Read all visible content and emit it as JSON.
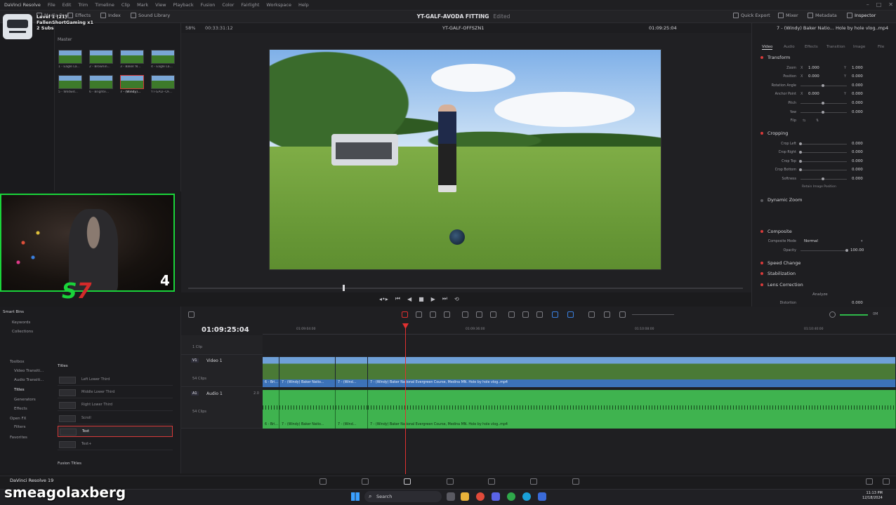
{
  "menubar": {
    "app_title": "DaVinci Resolve",
    "items": [
      "File",
      "Edit",
      "Trim",
      "Timeline",
      "Clip",
      "Mark",
      "View",
      "Playback",
      "Fusion",
      "Color",
      "Fairlight",
      "Workspace",
      "Help"
    ]
  },
  "toolbar": {
    "media_pool": "Media Pool",
    "effects": "Effects",
    "index": "Index",
    "sound_library": "Sound Library",
    "project_title": "YT-GALF-AVODA FITTING",
    "edited": "Edited",
    "quick_export": "Quick Export",
    "mixer": "Mixer",
    "metadata": "Metadata",
    "inspector": "Inspector"
  },
  "viewer": {
    "zoom": "58%",
    "source_timecode": "00:33:31:12",
    "timeline_name": "YT-GALF-OFFSZN1",
    "record_timecode": "01:09:25:04"
  },
  "overlay": {
    "line1": "Level 1 (21)",
    "line2": "FallenShortGaming x1",
    "line3": "2 Subs",
    "webcam_number": "4"
  },
  "media_pool": {
    "bin": "Master",
    "clips": [
      "1 - Eagle La...",
      "2 - Brownin...",
      "3 - Baker N...",
      "4 - Eagle La...",
      "5 - Wildwd...",
      "6 - Brighte...",
      "7 - (Windy)...",
      "YT-GALF-OF..."
    ]
  },
  "inspector": {
    "clip_title": "7 - (Windy) Baker Natio... Hole by hole vlog..mp4",
    "tabs": [
      "Video",
      "Audio",
      "Effects",
      "Transition",
      "Image",
      "File"
    ],
    "transform": {
      "title": "Transform",
      "zoom_label": "Zoom",
      "zoom_x": "1.000",
      "zoom_y": "1.000",
      "position_label": "Position",
      "position_x": "0.000",
      "position_y": "0.000",
      "rotation_label": "Rotation Angle",
      "rotation": "0.000",
      "anchor_label": "Anchor Point",
      "anchor_x": "0.000",
      "anchor_y": "0.000",
      "pitch_label": "Pitch",
      "pitch": "0.000",
      "yaw_label": "Yaw",
      "yaw": "0.000",
      "flip_label": "Flip"
    },
    "cropping": {
      "title": "Cropping",
      "left_label": "Crop Left",
      "left": "0.000",
      "right_label": "Crop Right",
      "right": "0.000",
      "top_label": "Crop Top",
      "top": "0.000",
      "bottom_label": "Crop Bottom",
      "bottom": "0.000",
      "softness_label": "Softness",
      "softness": "0.000",
      "retain_label": "Retain Image Position"
    },
    "dynamic_zoom": "Dynamic Zoom",
    "composite": {
      "title": "Composite",
      "mode_label": "Composite Mode",
      "mode": "Normal",
      "opacity_label": "Opacity",
      "opacity": "100.00"
    },
    "speed_change": "Speed Change",
    "stabilization": "Stabilization",
    "lens_correction": "Lens Correction",
    "analyze": "Analyze",
    "distortion_label": "Distortion",
    "distortion": "0.000"
  },
  "bins": {
    "smart_bins": "Smart Bins",
    "keywords": "Keywords",
    "collections": "Collections",
    "fx_tree": [
      "Toolbox",
      "Video Transiti...",
      "Audio Transiti...",
      "Titles",
      "Generators",
      "Effects",
      "Open FX",
      "Filters",
      "Favorites"
    ],
    "titles_header": "Titles",
    "titles": [
      "Left Lower Third",
      "Middle Lower Third",
      "Right Lower Third",
      "Scroll",
      "Text",
      "Text+"
    ],
    "fusion_titles": "Fusion Titles"
  },
  "timeline": {
    "timecode": "01:09:25:04",
    "ruler": [
      "01:09:04:00",
      "01:09:36:00",
      "01:10:08:00",
      "01:10:40:00"
    ],
    "clip_row_label": "1 Clip",
    "video_track": {
      "tag": "V1",
      "name": "Video 1",
      "clips": "54 Clips"
    },
    "audio_track": {
      "tag": "A1",
      "name": "Audio 1",
      "level": "2.0",
      "clips": "54 Clips"
    },
    "video_clip_labels": [
      "6 - Bri...",
      "7 - (Windy) Baker Natio...",
      "7 - (Wind...",
      "7 - (Windy) Baker National Evergreen Course, Medina MN. Hole by hole vlog..mp4"
    ],
    "audio_clip_labels": [
      "6 - Bri...",
      "7 - (Windy) Baker Natio...",
      "7 - (Wind...",
      "7 - (Windy) Baker National Evergreen Course, Medina MN. Hole by hole vlog..mp4"
    ],
    "volume": "0M"
  },
  "page_bar": {
    "brand": "DaVinci Resolve 19"
  },
  "taskbar": {
    "streamer": "smeagolaxberg",
    "search": "Search",
    "time": "11:13 PM",
    "date": "12/18/2024"
  },
  "colors": {
    "accent_red": "#e03030",
    "video_track": "#3c72b8",
    "audio_track": "#3fb34f",
    "frame_green": "#1ad43a"
  }
}
